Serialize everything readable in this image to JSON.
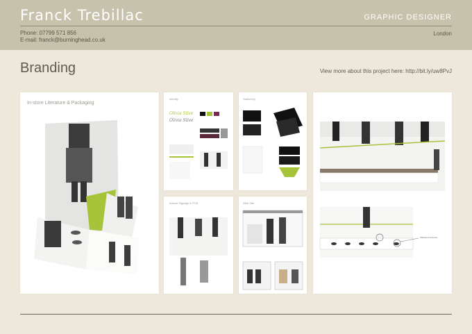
{
  "header": {
    "name": "Franck Trebillac",
    "role": "GRAPHIC DESIGNER",
    "phone": "Phone: 07799 571 856",
    "email": "E-mail: franck@burninghead.co.uk",
    "location": "London"
  },
  "section": {
    "title": "Branding",
    "link_text": "View more about this project here: http://bit.ly/uw8PvJ"
  },
  "cards": {
    "literature": {
      "label": "In-store Literature & Packaging"
    },
    "identity": {
      "label": "Identity"
    },
    "stationery": {
      "label": "Stationery"
    },
    "signage": {
      "label": "Instore Signage & POS"
    },
    "web": {
      "label": "Web Site"
    },
    "store": {
      "callout": "Window & Fixtures"
    }
  },
  "colors": {
    "accent_green": "#a6c43a",
    "header_bg": "#c6c2ab",
    "page_bg": "#ede8db"
  }
}
